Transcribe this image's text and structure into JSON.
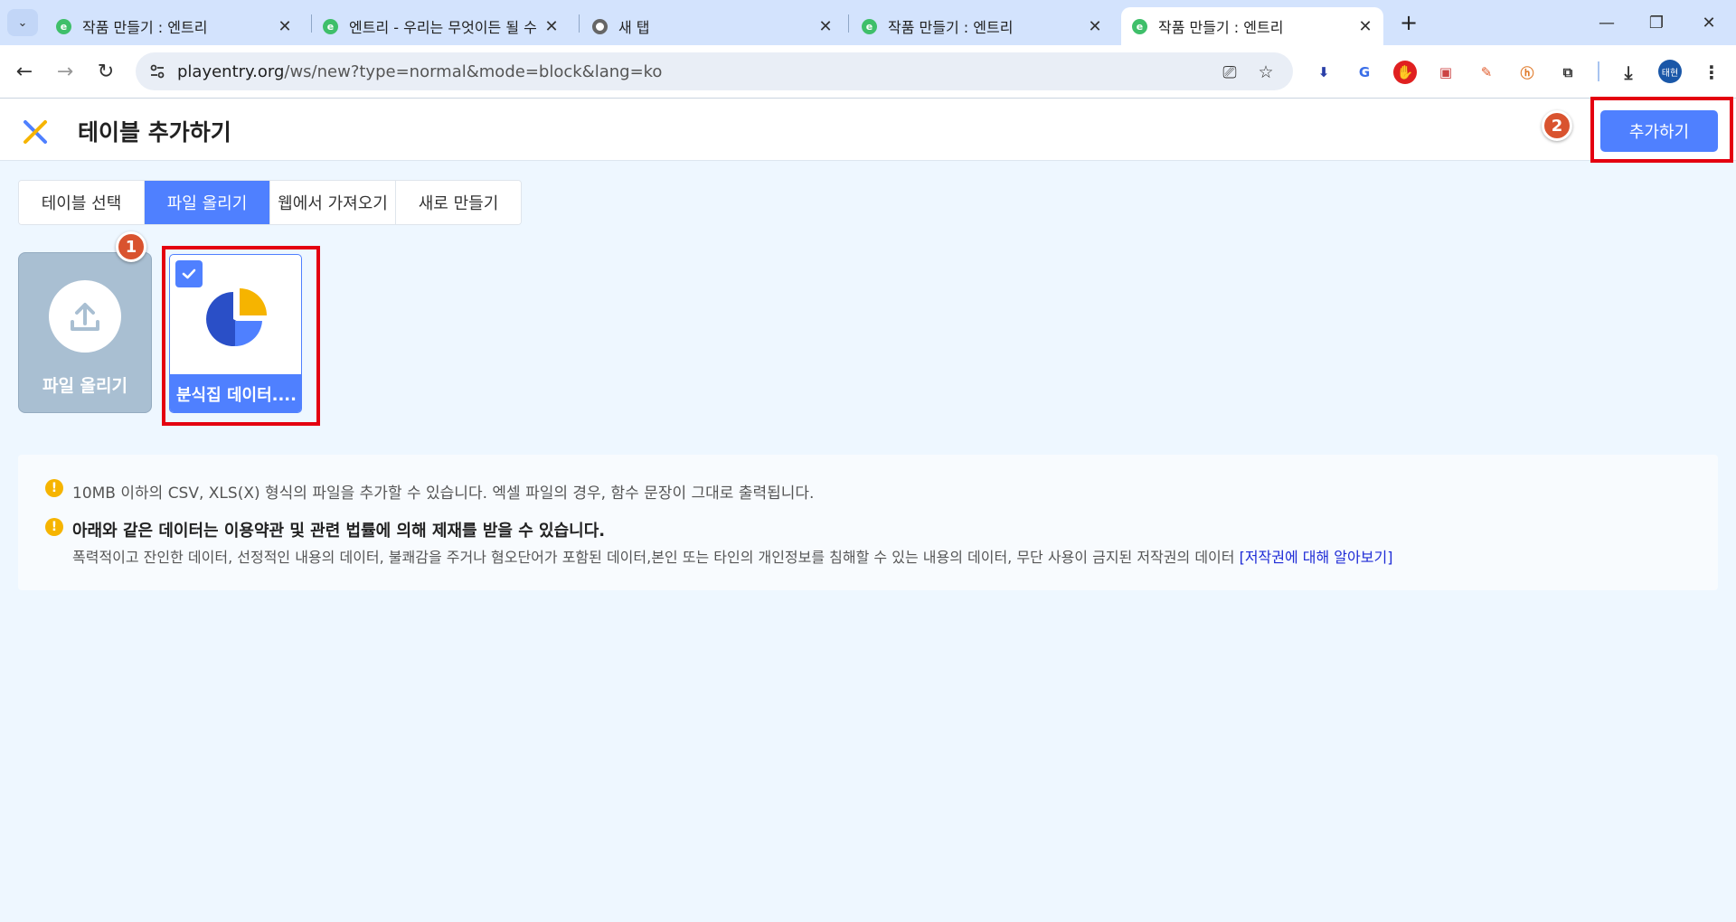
{
  "browser": {
    "tabs": [
      {
        "title": "작품 만들기 : 엔트리",
        "active": false
      },
      {
        "title": "엔트리 - 우리는 무엇이든 될 수",
        "active": false
      },
      {
        "title": "새 탭",
        "active": false
      },
      {
        "title": "작품 만들기 : 엔트리",
        "active": false
      },
      {
        "title": "작품 만들기 : 엔트리",
        "active": true
      }
    ],
    "url_host": "playentry.org",
    "url_path": "/ws/new?type=normal&mode=block&lang=ko",
    "profile_label": "태현"
  },
  "header": {
    "title": "테이블 추가하기",
    "add_button": "추가하기"
  },
  "tabs": [
    "테이블 선택",
    "파일 올리기",
    "웹에서 가져오기",
    "새로 만들기"
  ],
  "active_tab": 1,
  "upload_card": {
    "label": "파일 올리기"
  },
  "file_card": {
    "name": "분식집 데이터....",
    "checked": true
  },
  "annotations": {
    "badge1": "1",
    "badge2": "2"
  },
  "notice": {
    "line1": "10MB 이하의 CSV, XLS(X) 형식의 파일을 추가할 수 있습니다. 엑셀 파일의 경우, 함수 문장이 그대로 출력됩니다.",
    "line2_title": "아래와 같은 데이터는 이용약관 및 관련 법률에 의해 제재를 받을 수 있습니다.",
    "line2_detail": "폭력적이고 잔인한 데이터, 선정적인 내용의 데이터, 불쾌감을 주거나 혐오단어가 포함된 데이터,본인 또는 타인의 개인정보를 침해할 수 있는 내용의 데이터, 무단 사용이 금지된 저작권의 데이터 ",
    "link": "[저작권에 대해 알아보기]"
  },
  "colors": {
    "accent": "#4f80ff",
    "highlight": "#e40010",
    "badge": "#d9532f",
    "warning": "#f6b400"
  }
}
